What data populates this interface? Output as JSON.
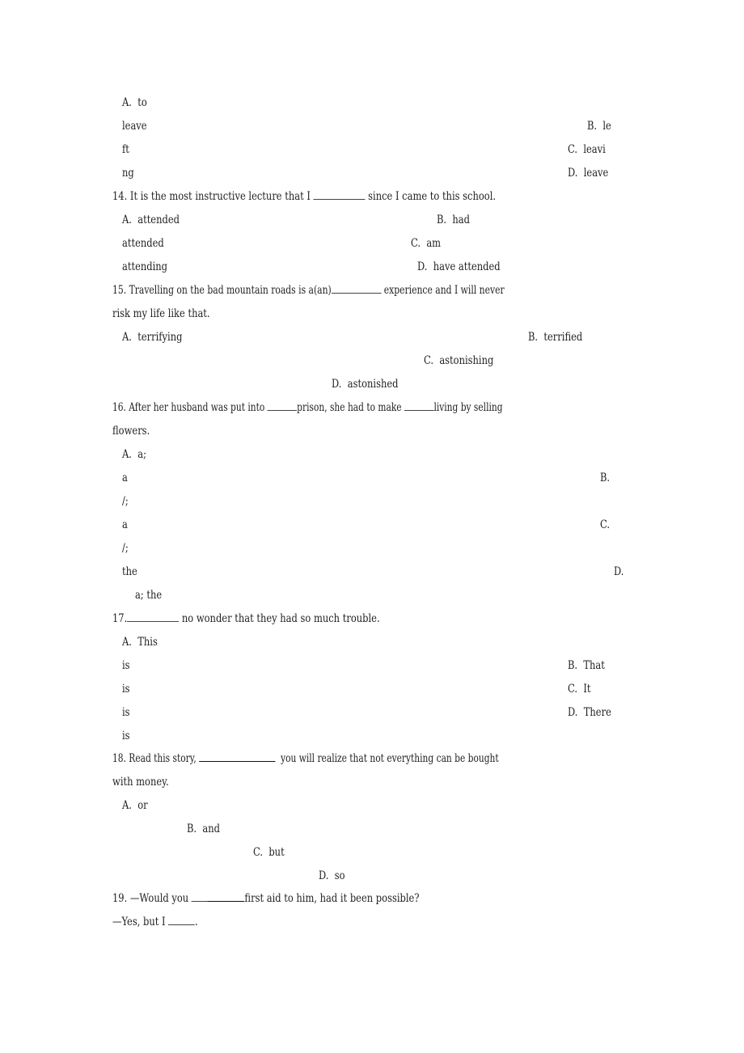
{
  "q13_options": {
    "l1": "A.  to",
    "l2a": "leave",
    "l2b": "B.  le",
    "l3a": "ft",
    "l3b": "C.  leavi",
    "l4a": "ng",
    "l4b": "D.  leave"
  },
  "q14": {
    "stem_pre": "14. It is the most instructive lecture that I ",
    "stem_post": " since I came to this school.",
    "l1a": "A.  attended",
    "l1b": "B.  had",
    "l2a": "attended",
    "l2b": "C.  am",
    "l3a": "attending",
    "l3b": "D.  have attended"
  },
  "q15": {
    "stem_pre": "15. Travelling on the bad mountain roads is a(an)",
    "stem_post": " experience and I will never",
    "stem_line2": "risk my life like that.",
    "optA": "A.  terrifying",
    "optB": "B.  terrified",
    "optC": "C.  astonishing",
    "optD": "D.  astonished"
  },
  "q16": {
    "stem_pre": "16. After her husband was put into ",
    "stem_mid": "prison, she had to make ",
    "stem_post": "living by selling",
    "stem_line2": "flowers.",
    "l1": "A.  a;",
    "l2a": "a",
    "l2b": "B.",
    "l3": "/;",
    "l4a": "a",
    "l4b": "C.",
    "l5": "/;",
    "l6a": "the",
    "l6b": "D.",
    "l7": "a; the"
  },
  "q17": {
    "stem_pre": "17.",
    "stem_post": " no wonder that they had so much trouble.",
    "l1": "A.  This",
    "l2a": "is",
    "l2b": "B.  That",
    "l3a": "is",
    "l3b": "C.  It",
    "l4a": "is",
    "l4b": "D.  There",
    "l5": "is"
  },
  "q18": {
    "stem_pre": "18. Read this story, ",
    "stem_post": "  you will realize that not everything can be bought",
    "stem_line2": "with money.",
    "optA": "A.  or",
    "optB": "B.  and",
    "optC": "C.  but",
    "optD": "D.  so"
  },
  "q19": {
    "stem_pre": "19. —Would you ",
    "stem_post": "first aid to him, had it been possible?",
    "line2_pre": "—Yes, but I ",
    "line2_post": "."
  }
}
